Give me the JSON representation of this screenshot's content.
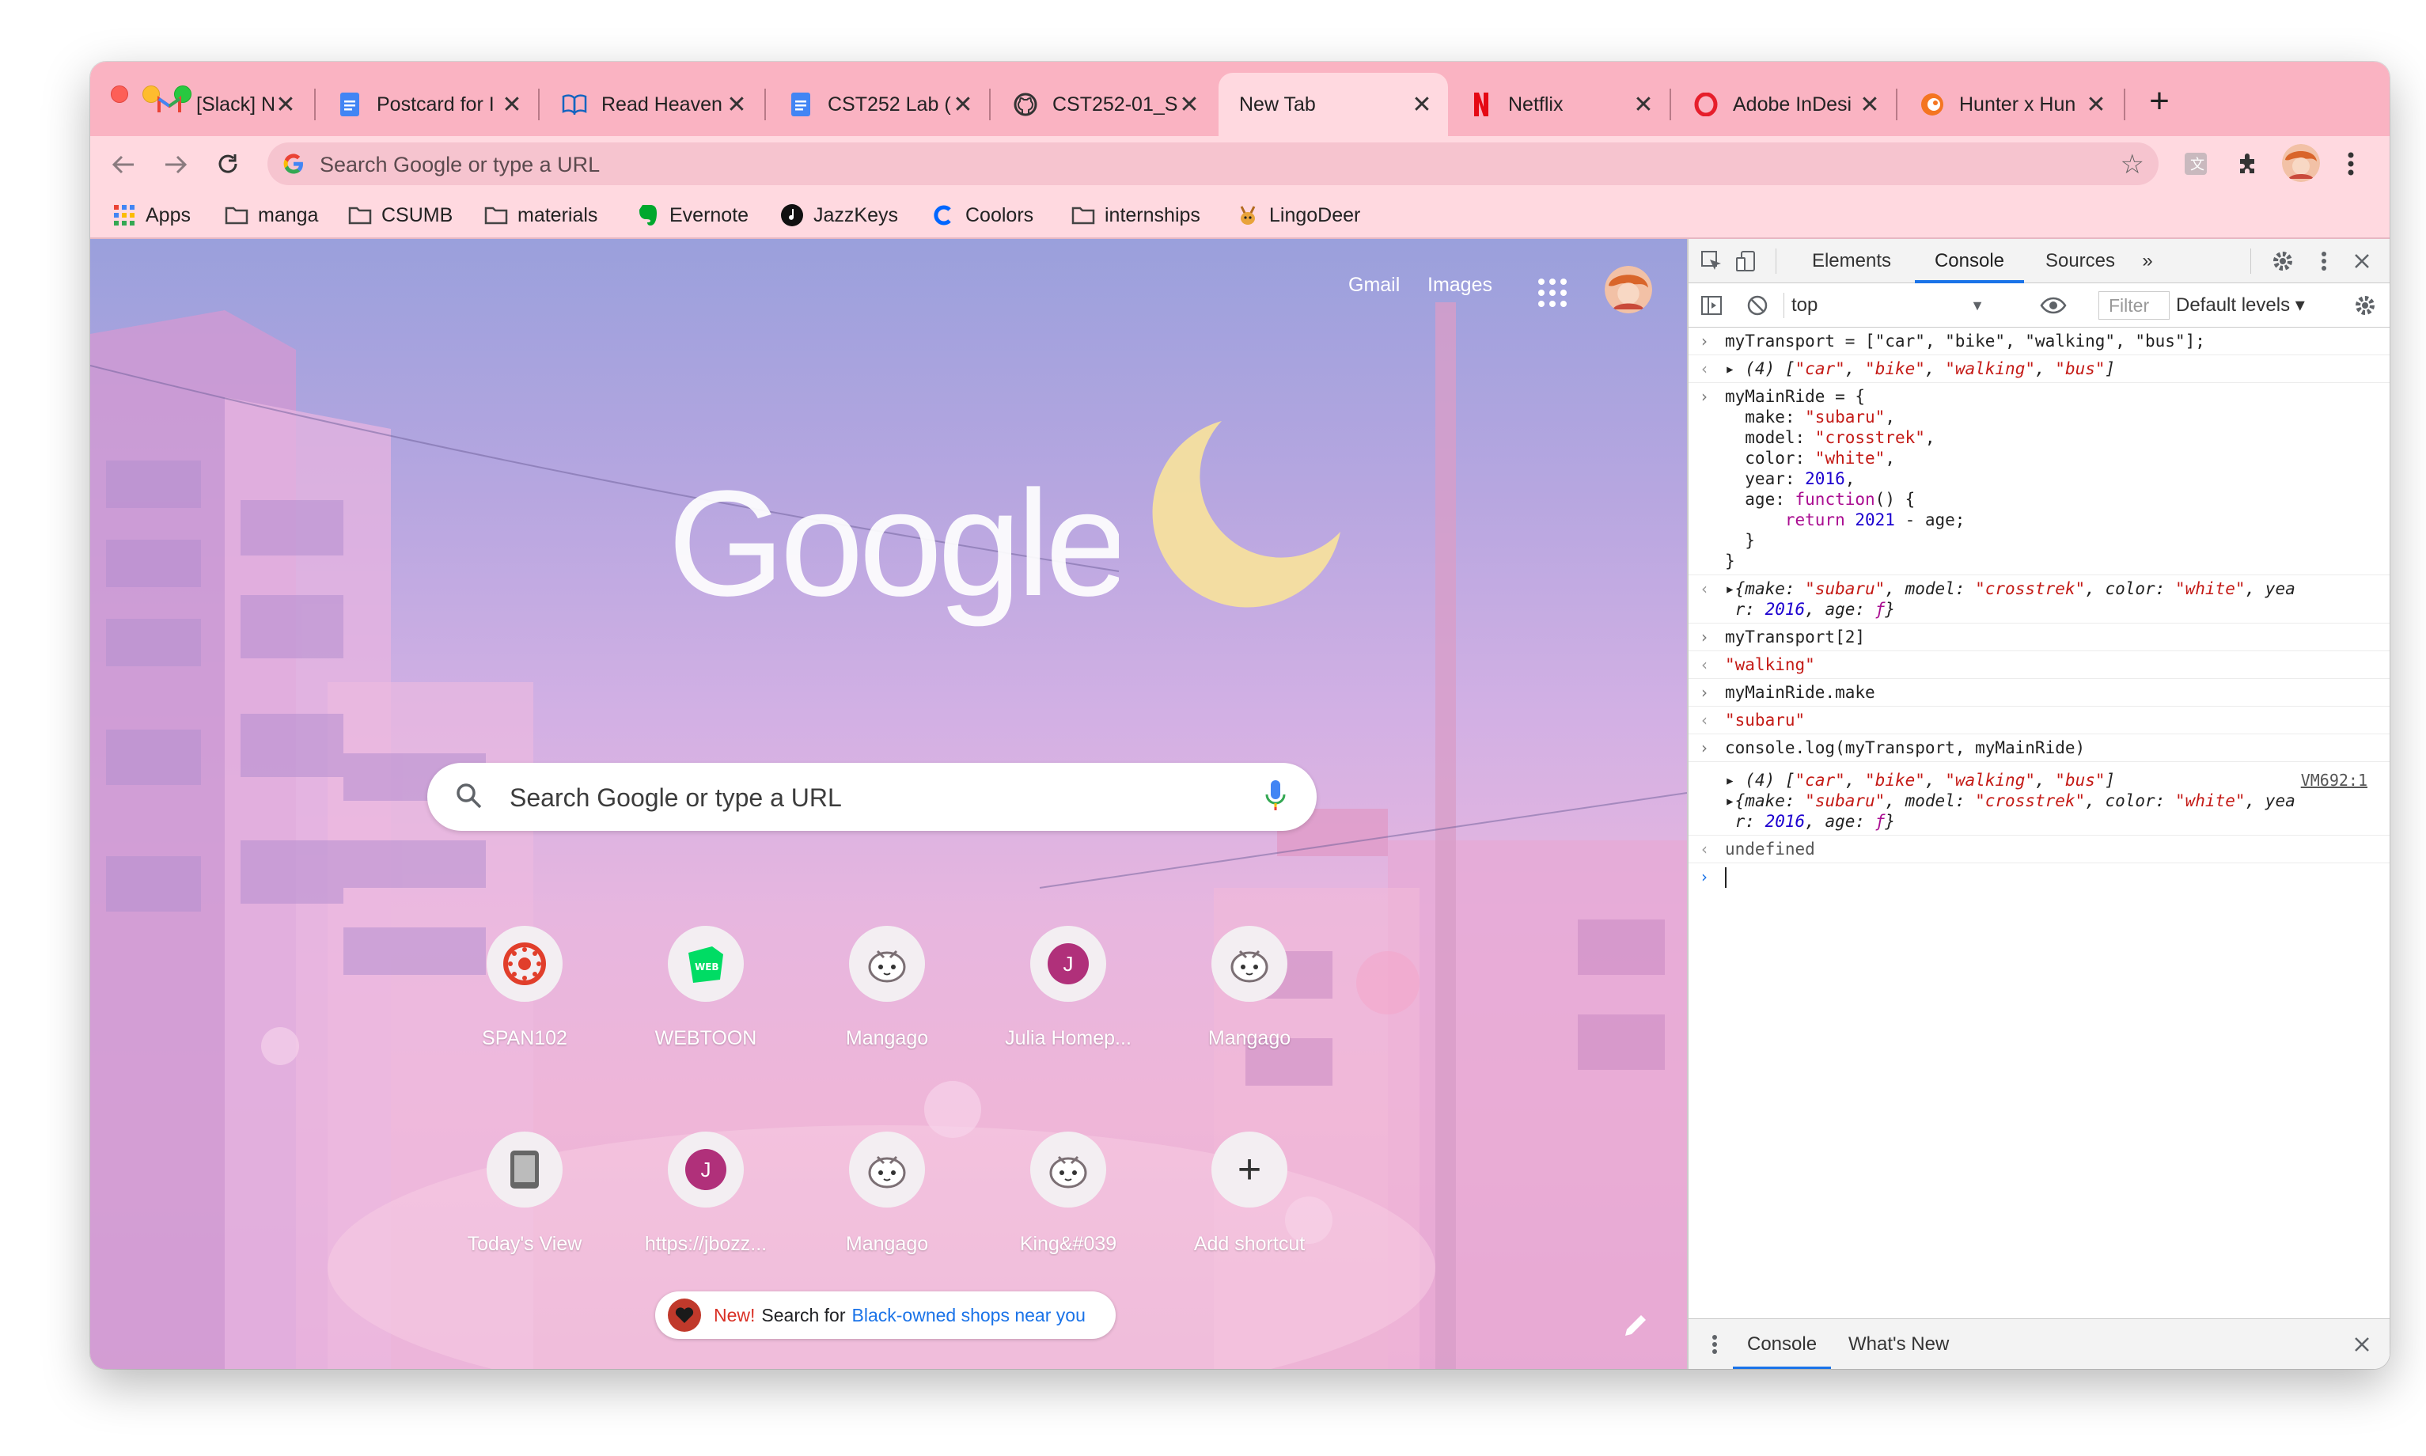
{
  "browser": {
    "tabs": [
      {
        "title": "[Slack] New m",
        "favicon": "gmail-icon",
        "active": false
      },
      {
        "title": "Postcard for I",
        "favicon": "google-docs-icon",
        "active": false
      },
      {
        "title": "Read Heaven",
        "favicon": "book-icon",
        "active": false
      },
      {
        "title": "CST252 Lab (",
        "favicon": "google-docs-icon",
        "active": false
      },
      {
        "title": "CST252-01_S",
        "favicon": "github-icon",
        "active": false
      },
      {
        "title": "New Tab",
        "favicon": "",
        "active": true
      },
      {
        "title": "Netflix",
        "favicon": "netflix-icon",
        "active": false
      },
      {
        "title": "Adobe InDesi",
        "favicon": "opera-icon",
        "active": false
      },
      {
        "title": "Hunter x Hun",
        "favicon": "crunchyroll-icon",
        "active": false
      }
    ],
    "newtab_symbol": "+",
    "close_symbol": "✕",
    "omnibox_placeholder": "Search Google or type a URL",
    "bookmarks": [
      {
        "label": "Apps",
        "icon": "apps-grid-icon"
      },
      {
        "label": "manga",
        "icon": "folder-icon"
      },
      {
        "label": "CSUMB",
        "icon": "folder-icon"
      },
      {
        "label": "materials",
        "icon": "folder-icon"
      },
      {
        "label": "Evernote",
        "icon": "evernote-icon"
      },
      {
        "label": "JazzKeys",
        "icon": "jazzkeys-icon"
      },
      {
        "label": "Coolors",
        "icon": "coolors-icon"
      },
      {
        "label": "internships",
        "icon": "folder-icon"
      },
      {
        "label": "LingoDeer",
        "icon": "lingodeer-icon"
      }
    ]
  },
  "newtab": {
    "top_links": {
      "gmail": "Gmail",
      "images": "Images"
    },
    "search_placeholder": "Search Google or type a URL",
    "shortcuts": [
      {
        "label": "SPAN102",
        "icon": "canvas-icon"
      },
      {
        "label": "WEBTOON",
        "icon": "webtoon-icon"
      },
      {
        "label": "Mangago",
        "icon": "mangago-icon"
      },
      {
        "label": "Julia Homep...",
        "icon": "letter-j-icon",
        "letter": "J"
      },
      {
        "label": "Mangago",
        "icon": "mangago-icon"
      },
      {
        "label": "Today's View",
        "icon": "tablet-icon"
      },
      {
        "label": "https://jbozz...",
        "icon": "letter-j-icon",
        "letter": "J"
      },
      {
        "label": "Mangago",
        "icon": "mangago-icon"
      },
      {
        "label": "King&#039",
        "icon": "mangago-icon"
      },
      {
        "label": "Add shortcut",
        "icon": "plus-icon",
        "symbol": "+"
      }
    ],
    "promo": {
      "new": "New!",
      "text": "Search for",
      "link": "Black-owned shops near you"
    }
  },
  "devtools": {
    "tabs": [
      "Elements",
      "Console",
      "Sources",
      "»"
    ],
    "active_tab": "Console",
    "context": "top",
    "filter_placeholder": "Filter",
    "levels": "Default levels ▾",
    "drawer_tabs": [
      "Console",
      "What's New"
    ],
    "console_source": "VM692:1",
    "console": {
      "l1": "myTransport = [\"car\", \"bike\", \"walking\", \"bus\"];",
      "l2_prefix": "(4) ",
      "arr": [
        "\"car\"",
        "\"bike\"",
        "\"walking\"",
        "\"bus\""
      ],
      "l3": [
        "myMainRide = {",
        "  make: ",
        "\"subaru\"",
        ",",
        "  model: ",
        "\"crosstrek\"",
        "  color: ",
        "\"white\"",
        "  year: ",
        "2016",
        "  age: ",
        "function",
        "() {",
        "      return ",
        "2021",
        " - age;",
        "  }",
        "}"
      ],
      "obj_line1": [
        "{make: ",
        "\"subaru\"",
        ", model: ",
        "\"crosstrek\"",
        ", color: ",
        "\"white\"",
        ", yea"
      ],
      "obj_line2": [
        "r: ",
        "2016",
        ", age: ",
        "ƒ",
        "}"
      ],
      "l5": "myTransport[2]",
      "l6": "\"walking\"",
      "l7": "myMainRide.make",
      "l8": "\"subaru\"",
      "l9": "console.log(myTransport, myMainRide)",
      "l12": "undefined"
    }
  },
  "colors": {
    "tabstrip": "#fab3c2",
    "toolbar": "#ffd9e0",
    "accent_blue": "#1a73e8"
  }
}
